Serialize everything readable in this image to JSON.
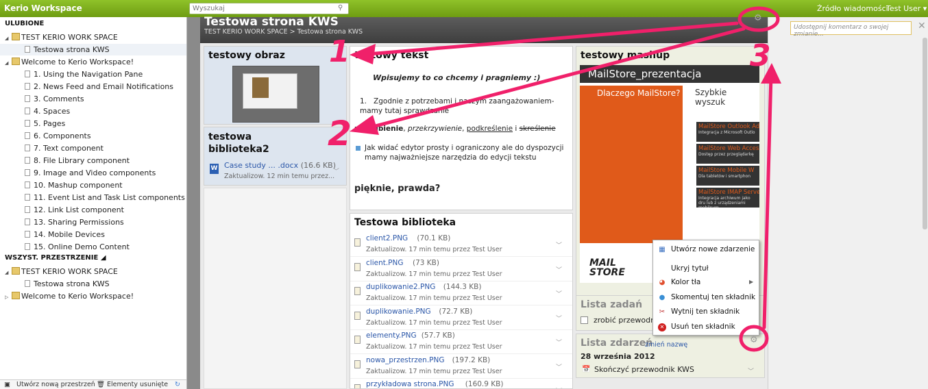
{
  "topbar": {
    "brand": "Kerio Workspace",
    "search_placeholder": "Wyszukaj",
    "news": "Źródło wiadomości",
    "user": "Test User ▾"
  },
  "sidebar": {
    "favorites_header": "ULUBIONE",
    "favorites": [
      {
        "label": "TEST KERIO WORK SPACE",
        "type": "space"
      },
      {
        "label": "Testowa strona KWS",
        "type": "page"
      },
      {
        "label": "Welcome to Kerio Workspace!",
        "type": "space"
      },
      {
        "label": "1. Using the Navigation Pane",
        "type": "page"
      },
      {
        "label": "2. News Feed and Email Notifications",
        "type": "page"
      },
      {
        "label": "3. Comments",
        "type": "page"
      },
      {
        "label": "4. Spaces",
        "type": "page"
      },
      {
        "label": "5. Pages",
        "type": "page"
      },
      {
        "label": "6. Components",
        "type": "page"
      },
      {
        "label": "7. Text component",
        "type": "page"
      },
      {
        "label": "8. File Library component",
        "type": "page"
      },
      {
        "label": "9. Image and Video components",
        "type": "page"
      },
      {
        "label": "10. Mashup component",
        "type": "page"
      },
      {
        "label": "11. Event List and Task List components",
        "type": "page"
      },
      {
        "label": "12. Link List component",
        "type": "page"
      },
      {
        "label": "13. Sharing Permissions",
        "type": "page"
      },
      {
        "label": "14. Mobile Devices",
        "type": "page"
      },
      {
        "label": "15. Online Demo Content",
        "type": "page"
      }
    ],
    "all_spaces_header": "WSZYST. PRZESTRZENIE ◢",
    "all_spaces": [
      {
        "label": "TEST KERIO WORK SPACE",
        "type": "space"
      },
      {
        "label": "Testowa strona KWS",
        "type": "page"
      },
      {
        "label": "Welcome to Kerio Workspace!",
        "type": "space"
      }
    ],
    "footer": {
      "create": "Utwórz nową przestrzeń",
      "deleted": "Elementy usunięte"
    }
  },
  "page": {
    "title": "Testowa strona KWS",
    "breadcrumb": "TEST KERIO WORK SPACE > Testowa strona KWS"
  },
  "image_card": {
    "title": "testowy obraz"
  },
  "library2": {
    "title1": "testowa",
    "title2": "biblioteka2",
    "file": "Case study ... .docx",
    "size": "(16.6 KB)",
    "meta": "Zaktualizow. 12 min temu przez..."
  },
  "text_card": {
    "title": "testowy tekst",
    "italic_line": "Wpisujemy to co chcemy i pragniemy :)",
    "list_item": "Zgodnie z potrzebami i naszym zaangażowaniem- mamy tutaj sprawdzanie",
    "format_bold": "pogrubienie",
    "format_italic": "przekrzywienie",
    "format_underline": "podkreślenie",
    "format_and": "i",
    "format_strike": "skreślenie",
    "bullet": "Jak widać edytor prosty i ograniczony ale do dyspozycji mamy najważniejsze narzędzia do edycji tekstu",
    "closing": "pięknie, prawda?"
  },
  "library": {
    "title": "Testowa biblioteka",
    "files": [
      {
        "name": "client2.PNG",
        "size": "(70.1 KB)",
        "meta": "Zaktualizow. 17 min temu przez Test User"
      },
      {
        "name": "client.PNG",
        "size": "(73 KB)",
        "meta": "Zaktualizow. 17 min temu przez Test User"
      },
      {
        "name": "duplikowanie2.PNG",
        "size": "(144.3 KB)",
        "meta": "Zaktualizow. 17 min temu przez Test User"
      },
      {
        "name": "duplikowanie.PNG",
        "size": "(72.7 KB)",
        "meta": "Zaktualizow. 17 min temu przez Test User"
      },
      {
        "name": "elementy.PNG",
        "size": "(57.7 KB)",
        "meta": "Zaktualizow. 17 min temu przez Test User"
      },
      {
        "name": "nowa_przestrzen.PNG",
        "size": "(197.2 KB)",
        "meta": "Zaktualizow. 17 min temu przez Test User"
      },
      {
        "name": "przykładowa strona.PNG",
        "size": "(160.9 KB)",
        "meta": ""
      }
    ]
  },
  "mashup": {
    "title": "testowy mashup",
    "embed_title": "MailStore_prezentacja",
    "why": "Dlaczego MailStore?",
    "quick": "Szybkie wyszuk",
    "logo1": "MAIL",
    "logo2": "STORE",
    "items": [
      {
        "head": "MailStore Outlook Add",
        "sub": "Integracja z Microsoft Outlo"
      },
      {
        "head": "MailStore Web Access",
        "sub": "Dostęp przez przeglądarkę"
      },
      {
        "head": "MailStore Mobile W",
        "sub": "Dla tabletów i smartphon"
      },
      {
        "head": "MailStore IMAP Serve",
        "sub": "Integracja archiwum jako dru lub z urządzeniami mobilnym"
      }
    ]
  },
  "tasks": {
    "title": "Lista zadań",
    "item": "zrobić przewodnik"
  },
  "events": {
    "title": "Lista zdarzeń",
    "rename": "zmień nazwę",
    "date": "28 września 2012",
    "item": "Skończyć przewodnik KWS"
  },
  "context_menu": {
    "items": [
      "Utwórz nowe zdarzenie",
      "Ukryj tytuł",
      "Kolor tła",
      "Skomentuj ten składnik",
      "Wytnij ten składnik",
      "Usuń ten składnik"
    ]
  },
  "comment": {
    "placeholder": "Udostępnij komentarz o swojej zmianie..."
  },
  "annotations": {
    "one": "1",
    "two": "2",
    "three": "3",
    "color": "#f0206a"
  },
  "colors": {
    "topbar": "#7fb11d",
    "title_bar": "#4a4a4a",
    "link": "#2a56a8",
    "mashup_orange": "#e05a1a"
  }
}
